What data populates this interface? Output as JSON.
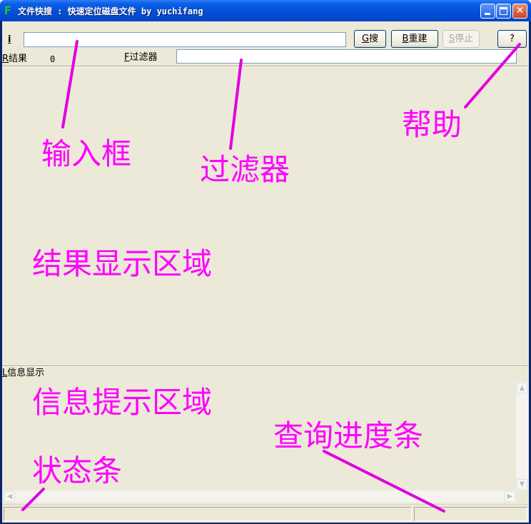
{
  "window": {
    "title": "文件快搜 : 快速定位磁盘文件 by yuchifang",
    "app_icon_glyph": "F"
  },
  "search_row": {
    "input_label_mnemonic": "i",
    "search_button": {
      "mnemonic": "G",
      "text": "搜"
    },
    "rebuild_button": {
      "mnemonic": "B",
      "text": "重建"
    },
    "stop_button": {
      "mnemonic": "S",
      "text": "停止"
    },
    "help_button": "?"
  },
  "results_row": {
    "results_mnemonic": "R",
    "results_label": "结果",
    "results_count": "0",
    "filter_mnemonic": "F",
    "filter_label": "过滤器"
  },
  "info_label": {
    "mnemonic": "L",
    "text": "信息显示"
  },
  "annotations": {
    "input_box": "输入框",
    "filter": "过滤器",
    "help": "帮助",
    "results_area": "结果显示区域",
    "info_area": "信息提示区域",
    "progress": "查询进度条",
    "status_bar": "状态条"
  },
  "colors": {
    "annotation": "#ff00ff",
    "face": "#ece9d8",
    "title_bar": "#0550d8"
  }
}
